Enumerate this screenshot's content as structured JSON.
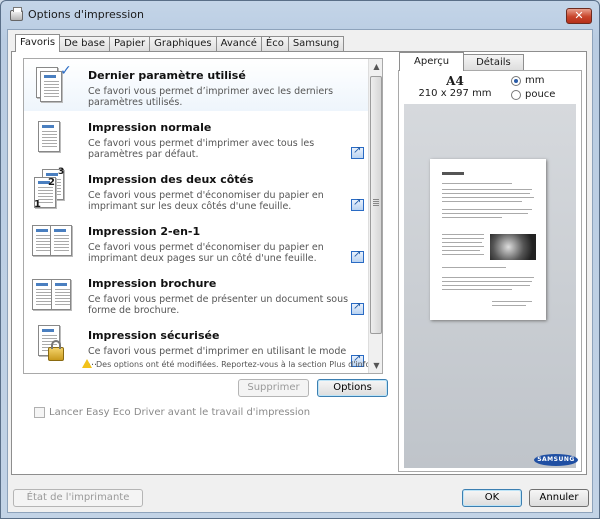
{
  "window": {
    "title": "Options d'impression",
    "close_glyph": "✕"
  },
  "tabs": [
    "Favoris",
    "De base",
    "Papier",
    "Graphiques",
    "Avancé",
    "Éco",
    "Samsung"
  ],
  "favorites": [
    {
      "name": "Dernier paramètre utilisé",
      "desc": "Ce favori vous permet d’imprimer avec les derniers paramètres utilisés."
    },
    {
      "name": "Impression normale",
      "desc": "Ce favori vous permet d'imprimer avec tous les paramètres par défaut."
    },
    {
      "name": "Impression des deux côtés",
      "desc": "Ce favori vous permet d'économiser du papier en imprimant sur les deux côtés d'une feuille."
    },
    {
      "name": "Impression 2-en-1",
      "desc": "Ce favori vous permet d'économiser du papier en imprimant deux pages sur un côté d'une feuille."
    },
    {
      "name": "Impression brochure",
      "desc": "Ce favori vous permet de présenter un document sous forme de brochure."
    },
    {
      "name": "Impression sécurisée",
      "desc": "Ce favori vous permet d'imprimer en utilisant le mode ..."
    }
  ],
  "warning": "Des options ont été modifiées. Reportez-vous à la section Plus d'info.",
  "buttons": {
    "delete": "Supprimer",
    "options": "Options",
    "printer_status": "État de l'imprimante",
    "ok": "OK",
    "cancel": "Annuler"
  },
  "checkbox": {
    "eco_driver": "Lancer Easy Eco Driver avant le travail d'impression",
    "checked": false
  },
  "preview": {
    "tabs": [
      "Aperçu",
      "Détails"
    ],
    "paper_size": "A4",
    "dimensions": "210 x 297 mm",
    "units": [
      "mm",
      "pouce"
    ],
    "selected_unit": "mm",
    "brand": "SAMSUNG"
  },
  "colors": {
    "accent": "#2a6bc4",
    "titlebar": "#c4d5e8",
    "close": "#c8452b"
  }
}
